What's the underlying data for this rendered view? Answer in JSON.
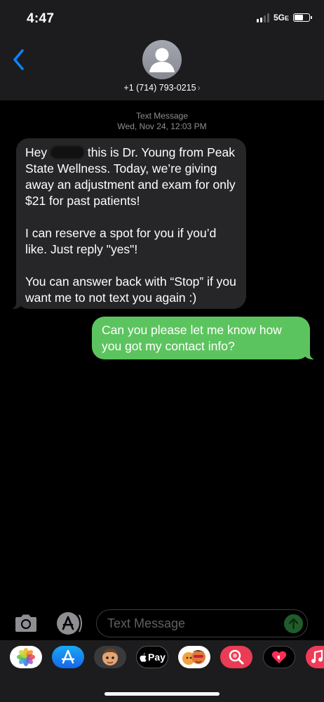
{
  "status_bar": {
    "time": "4:47",
    "network": "5G",
    "network_suffix": "E"
  },
  "header": {
    "contact": "+1 (714) 793-0215",
    "chevron": "›"
  },
  "conversation": {
    "meta_type": "Text Message",
    "meta_date": "Wed, Nov 24, 12:03 PM",
    "incoming": {
      "greeting": "Hey",
      "line1_rest": "this is Dr. Young from Peak State Wellness. Today, we’re giving away an adjustment and exam for only $21 for past patients!",
      "paragraph2": "I can reserve a spot for you if you’d like. Just reply \"yes\"!",
      "paragraph3": "You can answer back with “Stop” if you want me to not text you again :)"
    },
    "outgoing": "Can you please let me know how you got my contact info?"
  },
  "input_bar": {
    "placeholder": "Text Message"
  },
  "app_drawer": {
    "apps": [
      "photos-icon",
      "app-store-icon",
      "memoji-icon",
      "apple-pay-icon",
      "memoji-stickers-icon",
      "images-search-icon",
      "digital-touch-icon",
      "music-icon"
    ],
    "apple_pay_label": "Pay"
  },
  "colors": {
    "outgoing_bubble": "#5cc45e",
    "incoming_bubble": "#262628",
    "accent": "#0a84ff"
  }
}
